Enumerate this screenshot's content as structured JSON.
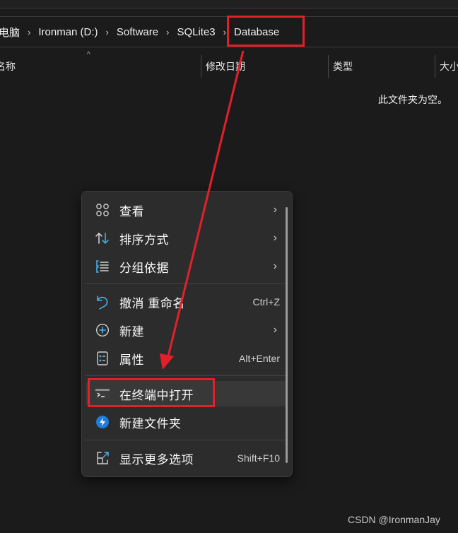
{
  "breadcrumb": {
    "items": [
      "电脑",
      "Ironman (D:)",
      "Software",
      "SQLite3",
      "Database"
    ],
    "separator": "›"
  },
  "columns": [
    {
      "label": "名称"
    },
    {
      "label": "修改日期"
    },
    {
      "label": "类型"
    },
    {
      "label": "大小"
    }
  ],
  "sort_indicator": "^",
  "empty_message": "此文件夹为空。",
  "context_menu": {
    "items": [
      {
        "label": "查看",
        "icon": "view-grid-icon",
        "submenu": true,
        "shortcut": null
      },
      {
        "label": "排序方式",
        "icon": "sort-arrows-icon",
        "submenu": true,
        "shortcut": null
      },
      {
        "label": "分组依据",
        "icon": "group-list-icon",
        "submenu": true,
        "shortcut": null
      },
      {
        "label": "撤消 重命名",
        "icon": "undo-icon",
        "submenu": false,
        "shortcut": "Ctrl+Z"
      },
      {
        "label": "新建",
        "icon": "new-plus-icon",
        "submenu": true,
        "shortcut": null
      },
      {
        "label": "属性",
        "icon": "properties-icon",
        "submenu": false,
        "shortcut": "Alt+Enter"
      },
      {
        "label": "在终端中打开",
        "icon": "terminal-icon",
        "submenu": false,
        "shortcut": null,
        "highlighted": true
      },
      {
        "label": "新建文件夹",
        "icon": "power-toys-icon",
        "submenu": false,
        "shortcut": null
      },
      {
        "label": "显示更多选项",
        "icon": "show-more-icon",
        "submenu": false,
        "shortcut": "Shift+F10"
      }
    ],
    "chevron": "›"
  },
  "annotation_color": "#e3202a",
  "accent_color": "#4cb4f0",
  "watermark": "CSDN @IronmanJay"
}
